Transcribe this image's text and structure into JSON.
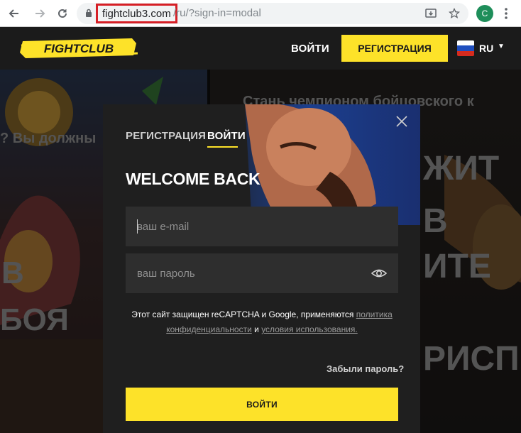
{
  "browser": {
    "url_host": "fightclub3.com",
    "url_path": "/ru/?sign-in=modal",
    "profile_initial": "C",
    "icons": [
      "back-icon",
      "forward-icon",
      "reload-icon",
      "lock-icon",
      "install-icon",
      "star-icon",
      "kebab-menu-icon"
    ]
  },
  "header": {
    "logo_text": "FIGHTCLUB",
    "login_label": "ВОЙТИ",
    "register_label": "РЕГИСТРАЦИЯ",
    "language": "RU",
    "colors": {
      "accent": "#fde229",
      "background": "#1b1b1b"
    }
  },
  "modal": {
    "tabs": [
      {
        "label": "РЕГИСТРАЦИЯ",
        "active": false
      },
      {
        "label": "ВОЙТИ",
        "active": true
      }
    ],
    "title": "WELCOME BACK",
    "email_placeholder": "ваш e-mail",
    "password_placeholder": "ваш пароль",
    "recaptcha_text": "Этот сайт защищен reCAPTCHA и Google, применяются",
    "privacy_link": "политика конфиденциальности",
    "and_text": "и",
    "terms_link": "условия использования.",
    "forgot_label": "Забыли пароль?",
    "submit_label": "ВОЙТИ"
  },
  "background": {
    "left_text_1": "? Вы должны",
    "left_text_2": "В",
    "left_text_3": "БОЯ",
    "right_text_1": "Стань чемпионом бойцовского к",
    "right_text_2": "ЖИТ",
    "right_text_3": "В",
    "right_text_4": "ИТЕ",
    "right_text_5": "РИСП"
  }
}
